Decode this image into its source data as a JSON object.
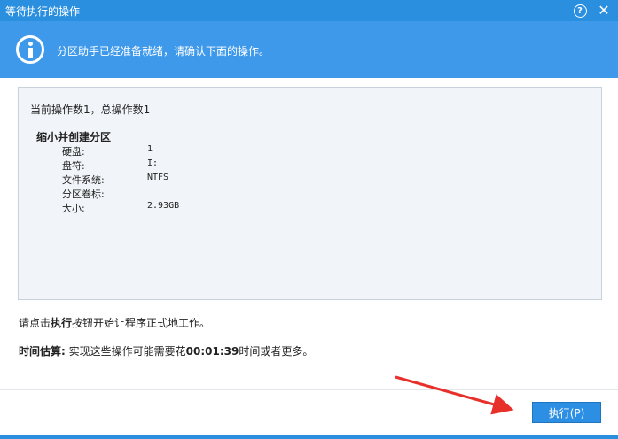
{
  "window": {
    "title": "等待执行的操作",
    "help_glyph": "?",
    "close_glyph": "✕"
  },
  "banner": {
    "message": "分区助手已经准备就绪，请确认下面的操作。"
  },
  "panel": {
    "summary": "当前操作数1，总操作数1",
    "operation_title": "缩小并创建分区",
    "details": [
      {
        "key": "硬盘:",
        "value": "1"
      },
      {
        "key": "盘符:",
        "value": "I:"
      },
      {
        "key": "文件系统:",
        "value": "NTFS"
      },
      {
        "key": "分区卷标:",
        "value": ""
      },
      {
        "key": "大小:",
        "value": "2.93GB"
      }
    ]
  },
  "instruction": {
    "prefix": "请点击",
    "bold": "执行",
    "suffix": "按钮开始让程序正式地工作。"
  },
  "estimate": {
    "label": "时间估算:",
    "prefix": " 实现这些操作可能需要花",
    "time": "00:01:39",
    "suffix": "时间或者更多。"
  },
  "footer": {
    "execute_label": "执行(P)"
  },
  "colors": {
    "titlebar": "#2b8fe0",
    "banner": "#3e99eb",
    "button": "#2d8fe3",
    "arrow": "#e8302b"
  },
  "icons": [
    "info-icon",
    "help-icon",
    "close-icon",
    "arrow-annotation"
  ]
}
